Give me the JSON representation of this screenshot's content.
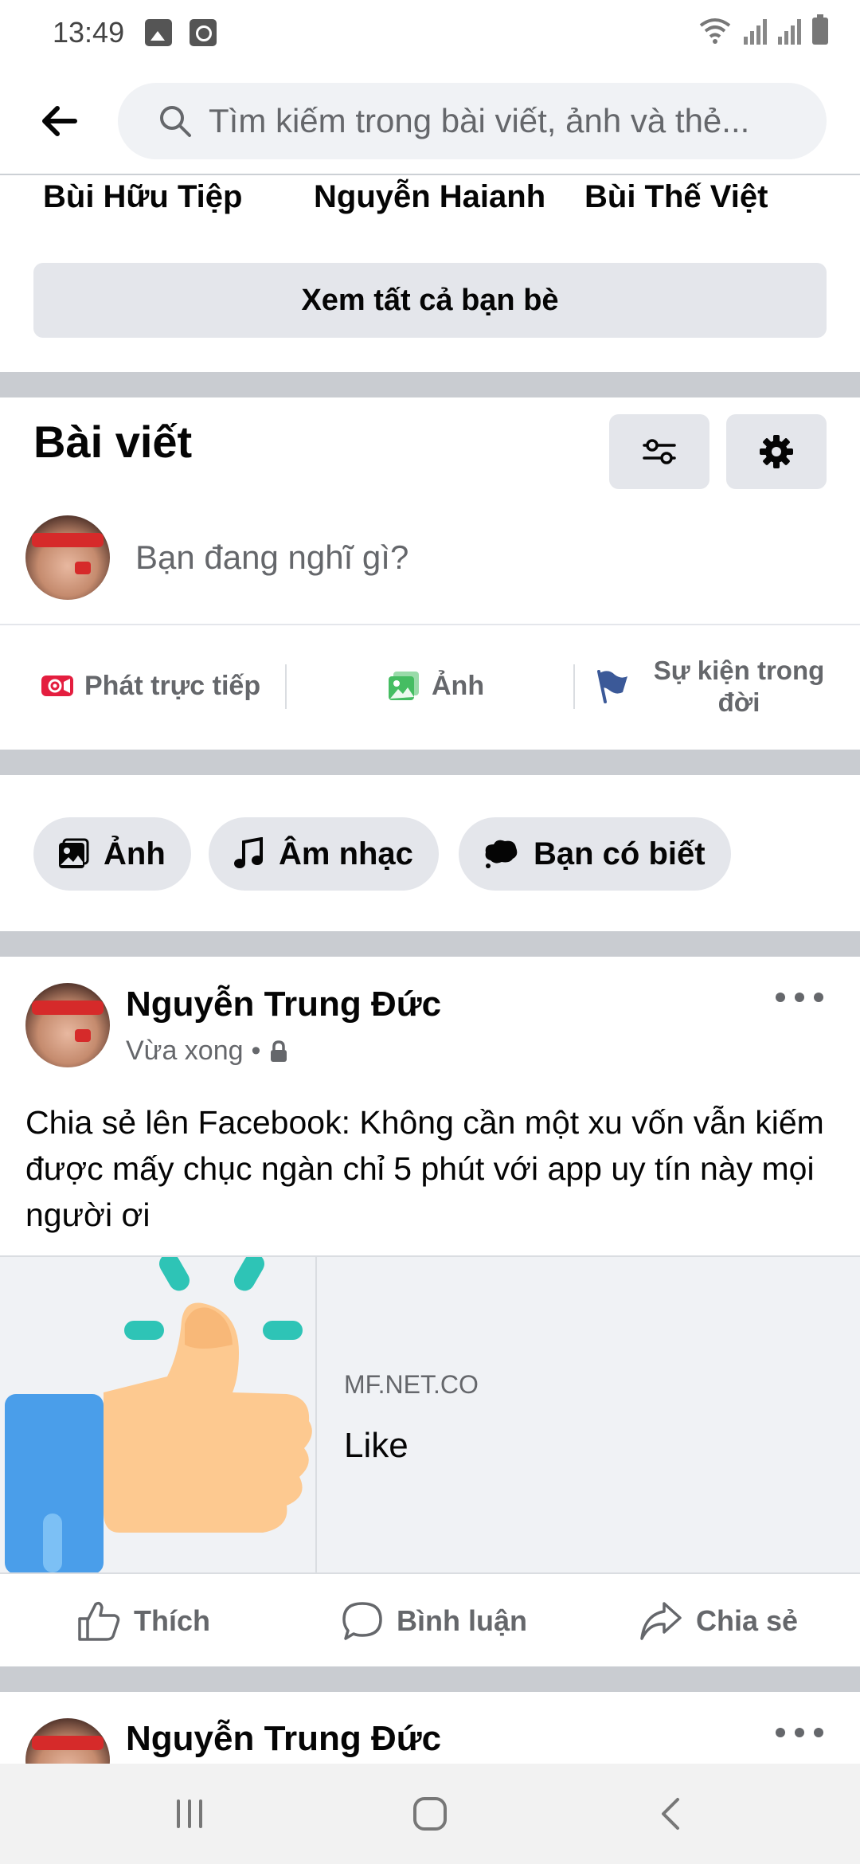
{
  "status_bar": {
    "time": "13:49"
  },
  "header": {
    "search_placeholder": "Tìm kiếm trong bài viết, ảnh và thẻ..."
  },
  "friends": {
    "names": [
      "Bùi Hữu Tiệp",
      "Nguyễn Haianh",
      "Bùi Thế Việt"
    ],
    "see_all_label": "Xem tất cả bạn bè"
  },
  "posts_section": {
    "title": "Bài viết",
    "composer_placeholder": "Bạn đang nghĩ gì?",
    "actions": [
      {
        "label": "Phát trực tiếp"
      },
      {
        "label": "Ảnh"
      },
      {
        "label": "Sự kiện trong đời"
      }
    ],
    "chips": [
      {
        "label": "Ảnh"
      },
      {
        "label": "Âm nhạc"
      },
      {
        "label": "Bạn có biết"
      }
    ]
  },
  "post": {
    "author": "Nguyễn Trung Đức",
    "time": "Vừa xong",
    "text": "Chia sẻ lên Facebook: Không cần một xu vốn vẫn kiếm được mấy chục ngàn chỉ 5 phút với app uy tín này mọi người ơi",
    "link": {
      "domain": "MF.NET.CO",
      "title": "Like"
    },
    "actions": {
      "like": "Thích",
      "comment": "Bình luận",
      "share": "Chia sẻ"
    }
  },
  "next_post": {
    "author": "Nguyễn Trung Đức"
  },
  "colors": {
    "accent_red": "#e41e3f",
    "photo_green": "#45bd62",
    "flag_blue": "#3b5998",
    "divider": "#c9ccd1"
  }
}
